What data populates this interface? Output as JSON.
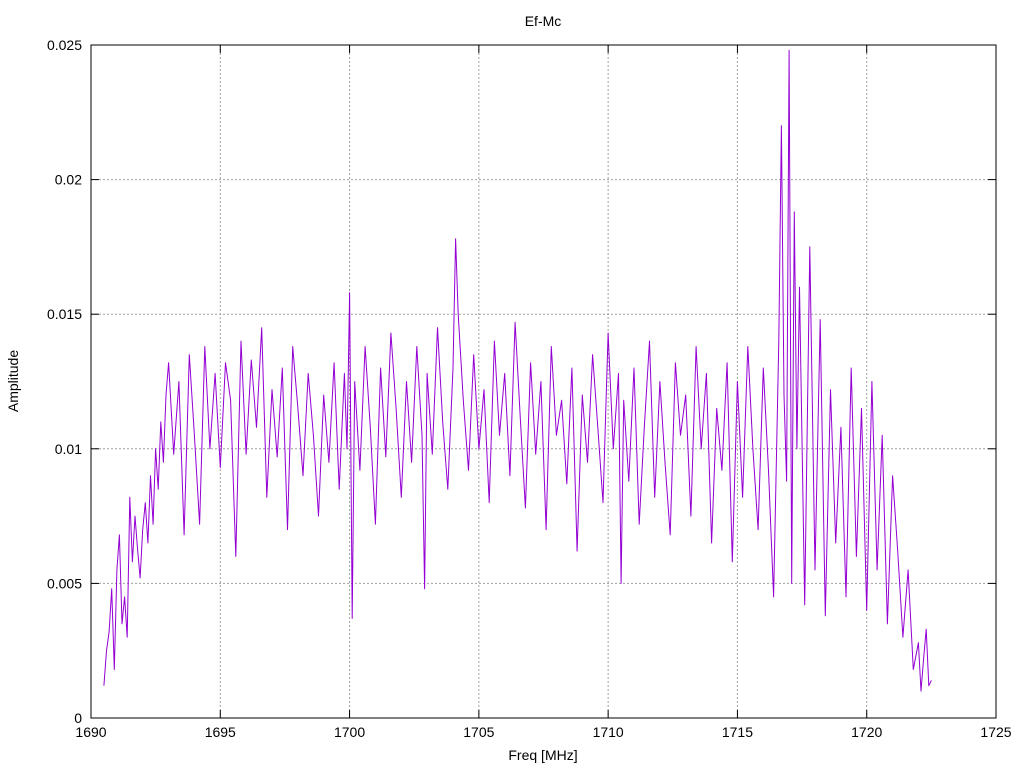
{
  "chart_data": {
    "type": "line",
    "title": "Ef-Mc",
    "xlabel": "Freq [MHz]",
    "ylabel": "Amplitude",
    "xlim": [
      1690,
      1725
    ],
    "ylim": [
      0,
      0.025
    ],
    "x_ticks": [
      1690,
      1695,
      1700,
      1705,
      1710,
      1715,
      1720,
      1725
    ],
    "x_tick_labels": [
      "1690",
      "1695",
      "1700",
      "1705",
      "1710",
      "1715",
      "1720",
      "1725"
    ],
    "y_ticks": [
      0,
      0.005,
      0.01,
      0.015,
      0.02,
      0.025
    ],
    "y_tick_labels": [
      "0",
      "0.005",
      "0.01",
      "0.015",
      "0.02",
      "0.025"
    ],
    "grid": true,
    "line_color": "#9400d3",
    "series": [
      {
        "x": [
          1690.5,
          1690.6,
          1690.7,
          1690.8,
          1690.9,
          1691.0,
          1691.1,
          1691.2,
          1691.3,
          1691.4,
          1691.5,
          1691.6,
          1691.7,
          1691.8,
          1691.9,
          1692.0,
          1692.1,
          1692.2,
          1692.3,
          1692.4,
          1692.5,
          1692.6,
          1692.7,
          1692.8,
          1692.9,
          1693.0,
          1693.2,
          1693.4,
          1693.6,
          1693.8,
          1694.0,
          1694.2,
          1694.4,
          1694.6,
          1694.8,
          1695.0,
          1695.2,
          1695.4,
          1695.6,
          1695.8,
          1696.0,
          1696.2,
          1696.4,
          1696.6,
          1696.8,
          1697.0,
          1697.2,
          1697.4,
          1697.6,
          1697.8,
          1698.0,
          1698.2,
          1698.4,
          1698.6,
          1698.8,
          1699.0,
          1699.2,
          1699.4,
          1699.6,
          1699.8,
          1699.9,
          1700.0,
          1700.1,
          1700.2,
          1700.4,
          1700.6,
          1700.8,
          1701.0,
          1701.2,
          1701.4,
          1701.6,
          1701.8,
          1702.0,
          1702.2,
          1702.4,
          1702.6,
          1702.8,
          1702.9,
          1703.0,
          1703.2,
          1703.4,
          1703.6,
          1703.8,
          1704.0,
          1704.1,
          1704.2,
          1704.4,
          1704.6,
          1704.8,
          1705.0,
          1705.2,
          1705.4,
          1705.6,
          1705.8,
          1706.0,
          1706.2,
          1706.4,
          1706.6,
          1706.8,
          1707.0,
          1707.2,
          1707.4,
          1707.6,
          1707.8,
          1708.0,
          1708.2,
          1708.4,
          1708.6,
          1708.8,
          1709.0,
          1709.2,
          1709.4,
          1709.6,
          1709.8,
          1710.0,
          1710.2,
          1710.4,
          1710.5,
          1710.6,
          1710.8,
          1711.0,
          1711.2,
          1711.4,
          1711.6,
          1711.8,
          1712.0,
          1712.2,
          1712.4,
          1712.6,
          1712.8,
          1713.0,
          1713.2,
          1713.4,
          1713.6,
          1713.8,
          1714.0,
          1714.2,
          1714.4,
          1714.6,
          1714.8,
          1715.0,
          1715.2,
          1715.4,
          1715.6,
          1715.8,
          1716.0,
          1716.2,
          1716.4,
          1716.6,
          1716.7,
          1716.8,
          1716.9,
          1717.0,
          1717.1,
          1717.2,
          1717.3,
          1717.4,
          1717.6,
          1717.8,
          1718.0,
          1718.2,
          1718.4,
          1718.6,
          1718.8,
          1719.0,
          1719.2,
          1719.4,
          1719.6,
          1719.8,
          1720.0,
          1720.2,
          1720.4,
          1720.6,
          1720.8,
          1721.0,
          1721.2,
          1721.4,
          1721.6,
          1721.8,
          1722.0,
          1722.1,
          1722.2,
          1722.3,
          1722.4,
          1722.5
        ],
        "y": [
          0.0012,
          0.0025,
          0.0032,
          0.0048,
          0.0018,
          0.0055,
          0.0068,
          0.0035,
          0.0045,
          0.003,
          0.0082,
          0.0058,
          0.0075,
          0.0063,
          0.0052,
          0.007,
          0.008,
          0.0065,
          0.009,
          0.0072,
          0.01,
          0.0085,
          0.011,
          0.0095,
          0.012,
          0.0132,
          0.0098,
          0.0125,
          0.0068,
          0.0135,
          0.0105,
          0.0072,
          0.0138,
          0.01,
          0.0128,
          0.0093,
          0.0132,
          0.0118,
          0.006,
          0.014,
          0.0098,
          0.0133,
          0.0108,
          0.0145,
          0.0082,
          0.0122,
          0.0097,
          0.013,
          0.007,
          0.0138,
          0.0115,
          0.009,
          0.0128,
          0.0105,
          0.0075,
          0.012,
          0.0095,
          0.0132,
          0.0085,
          0.0128,
          0.01,
          0.0158,
          0.0037,
          0.0125,
          0.0092,
          0.0138,
          0.0108,
          0.0072,
          0.013,
          0.0097,
          0.0143,
          0.0115,
          0.0082,
          0.0125,
          0.0095,
          0.0138,
          0.0105,
          0.0048,
          0.0128,
          0.0098,
          0.0145,
          0.011,
          0.0085,
          0.013,
          0.0178,
          0.015,
          0.0118,
          0.0092,
          0.0135,
          0.01,
          0.0122,
          0.008,
          0.014,
          0.0105,
          0.0128,
          0.009,
          0.0147,
          0.0112,
          0.0078,
          0.0132,
          0.0098,
          0.0125,
          0.007,
          0.0138,
          0.0105,
          0.0118,
          0.0087,
          0.013,
          0.0062,
          0.012,
          0.0095,
          0.0135,
          0.0108,
          0.008,
          0.0143,
          0.01,
          0.0128,
          0.005,
          0.0118,
          0.0088,
          0.013,
          0.0072,
          0.0108,
          0.014,
          0.0082,
          0.0125,
          0.0095,
          0.0068,
          0.0132,
          0.0105,
          0.012,
          0.0075,
          0.0138,
          0.01,
          0.0128,
          0.0065,
          0.0115,
          0.0092,
          0.0132,
          0.0058,
          0.0125,
          0.0082,
          0.0138,
          0.01,
          0.007,
          0.013,
          0.0092,
          0.0045,
          0.014,
          0.022,
          0.012,
          0.0088,
          0.0248,
          0.005,
          0.0188,
          0.01,
          0.016,
          0.0042,
          0.0175,
          0.0055,
          0.0148,
          0.0038,
          0.0122,
          0.0065,
          0.0108,
          0.0045,
          0.013,
          0.006,
          0.0115,
          0.004,
          0.0125,
          0.0055,
          0.0105,
          0.0035,
          0.009,
          0.0062,
          0.003,
          0.0055,
          0.0018,
          0.0028,
          0.001,
          0.0022,
          0.0033,
          0.0012,
          0.0014
        ],
        "color": "#9400d3"
      }
    ]
  }
}
